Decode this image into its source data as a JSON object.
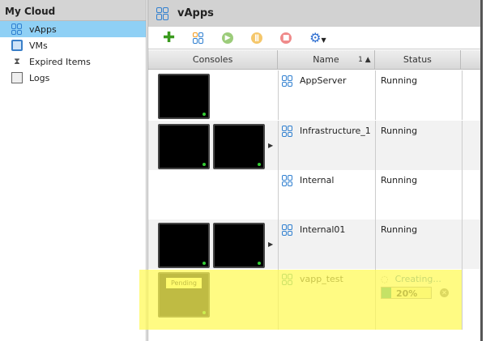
{
  "sidebar": {
    "title": "My Cloud",
    "items": [
      {
        "label": "vApps",
        "icon": "vapps-icon",
        "selected": true
      },
      {
        "label": "VMs",
        "icon": "vms-icon"
      },
      {
        "label": "Expired Items",
        "icon": "hourglass-icon"
      },
      {
        "label": "Logs",
        "icon": "logs-icon"
      }
    ]
  },
  "main": {
    "title": "vApps",
    "toolbar": [
      "add-icon",
      "new-vapp-icon",
      "start-icon",
      "suspend-icon",
      "stop-icon",
      "gear-menu-icon"
    ],
    "columns": {
      "consoles": "Consoles",
      "name": "Name",
      "sort": "1 ▲",
      "status": "Status"
    },
    "rows": [
      {
        "name": "AppServer",
        "status": "Running",
        "consoles": 1
      },
      {
        "name": "Infrastructure_1",
        "status": "Running",
        "consoles": 2
      },
      {
        "name": "Internal",
        "status": "Running",
        "consoles": 0
      },
      {
        "name": "Internal01",
        "status": "Running",
        "consoles": 2
      },
      {
        "name": "vapp_test",
        "status": "Creating...",
        "console_label": "Pending",
        "progress_text": "20%",
        "progress": 0.2
      }
    ]
  },
  "colors": {
    "selected": "#8fd0f5",
    "highlight": "#fffa5a",
    "accent": "#2f7fd0"
  }
}
